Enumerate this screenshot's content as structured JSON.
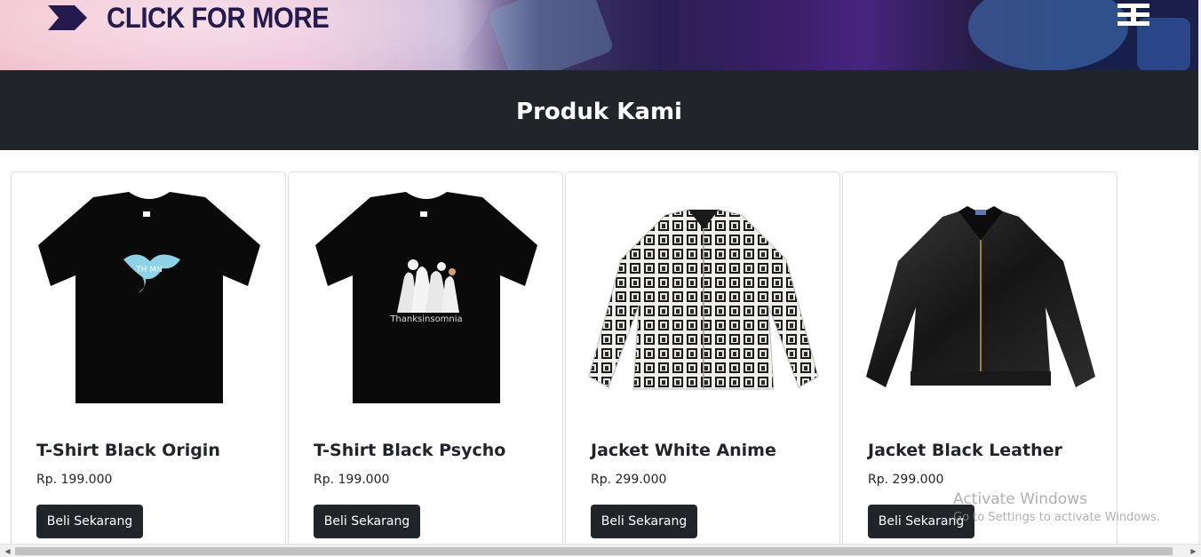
{
  "banner": {
    "cta_text": "CLICK FOR MORE",
    "arrow_icon": "double-chevron-right-icon",
    "logo_icon": "brand-logo-icon"
  },
  "section": {
    "title": "Produk Kami"
  },
  "products": [
    {
      "name": "T-Shirt Black Origin",
      "price": "Rp. 199.000",
      "button_label": "Beli Sekarang",
      "image_icon": "tshirt-black-origin-image"
    },
    {
      "name": "T-Shirt Black Psycho",
      "price": "Rp. 199.000",
      "button_label": "Beli Sekarang",
      "image_icon": "tshirt-black-psycho-image"
    },
    {
      "name": "Jacket White Anime",
      "price": "Rp. 299.000",
      "button_label": "Beli Sekarang",
      "image_icon": "jacket-white-anime-image"
    },
    {
      "name": "Jacket Black Leather",
      "price": "Rp. 299.000",
      "button_label": "Beli Sekarang",
      "image_icon": "jacket-black-leather-image"
    }
  ],
  "watermark": {
    "title": "Activate Windows",
    "subtitle": "Go to Settings to activate Windows."
  },
  "scrollbar": {
    "left_arrow": "◀",
    "right_arrow": "▶"
  },
  "colors": {
    "header_bg": "#212529",
    "button_bg": "#212529",
    "cta_text": "#241a4e"
  }
}
